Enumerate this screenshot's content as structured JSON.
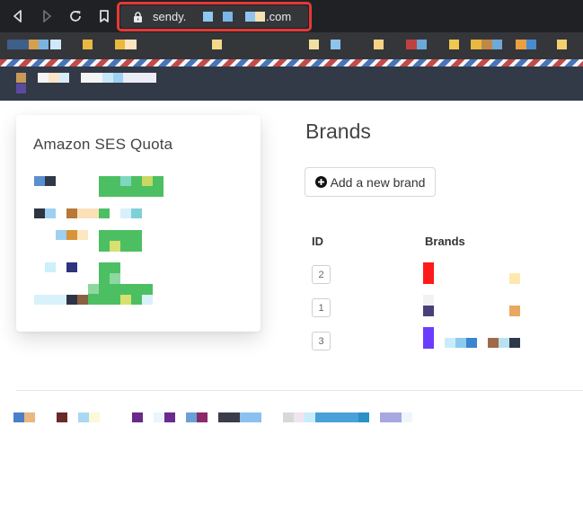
{
  "browser": {
    "url_host": "sendy.",
    "url_tld": ".com",
    "nav": [
      "back-icon",
      "forward-icon",
      "reload-icon",
      "bookmark-icon"
    ]
  },
  "quota": {
    "title": "Amazon SES Quota"
  },
  "brands": {
    "heading": "Brands",
    "add_button_label": "Add a new brand",
    "columns": {
      "id": "ID",
      "brands": "Brands"
    },
    "rows": [
      {
        "id": "2",
        "color": "#ff1a1a"
      },
      {
        "id": "1",
        "color": "#4a3f7a"
      },
      {
        "id": "3",
        "color": "#6a3cff"
      }
    ]
  },
  "colors": {
    "chrome_bg": "#202124",
    "address_outline": "#e53935",
    "header_bg": "#323a47",
    "quota_green": "#4cbf62"
  }
}
